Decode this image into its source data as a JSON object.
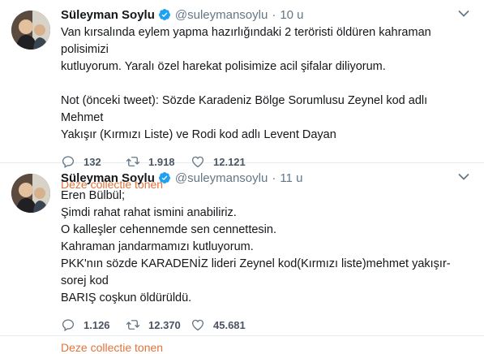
{
  "colors": {
    "link": "#e0733a",
    "verified": "#1da1f2",
    "muted": "#657786"
  },
  "tweets": [
    {
      "name": "Süleyman Soylu",
      "handle": "@suleymansoylu",
      "separator": "·",
      "time": "10 u",
      "lines": [
        "Van kırsalında eylem yapma hazırlığındaki 2 teröristi öldüren kahraman polisimizi",
        "kutluyorum. Yaralı özel harekat polisimize acil şifalar diliyorum.",
        "",
        "Not (önceki tweet): Sözde Karadeniz Bölge Sorumlusu Zeynel kod adlı Mehmet",
        "Yakışır (Kırmızı Liste) ve Rodi kod adlı Levent Dayan"
      ],
      "replies": "132",
      "retweets": "1.918",
      "likes": "12.121",
      "collection_link": "Deze collectie tonen"
    },
    {
      "name": "Süleyman Soylu",
      "handle": "@suleymansoylu",
      "separator": "·",
      "time": "11 u",
      "lines": [
        "Eren Bülbül;",
        "Şimdi rahat rahat ismini anabiliriz.",
        "O kalleşler cehennemde sen cennettesin.",
        "Kahraman jandarmamızı kutluyorum.",
        "PKK'nın sözde KARADENİZ lideri Zeynel kod(Kırmızı liste)mehmet yakışır- sorej kod",
        "BARIŞ coşkun öldürüldü."
      ],
      "replies": "1.126",
      "retweets": "12.370",
      "likes": "45.681",
      "collection_link": "Deze collectie tonen"
    }
  ]
}
